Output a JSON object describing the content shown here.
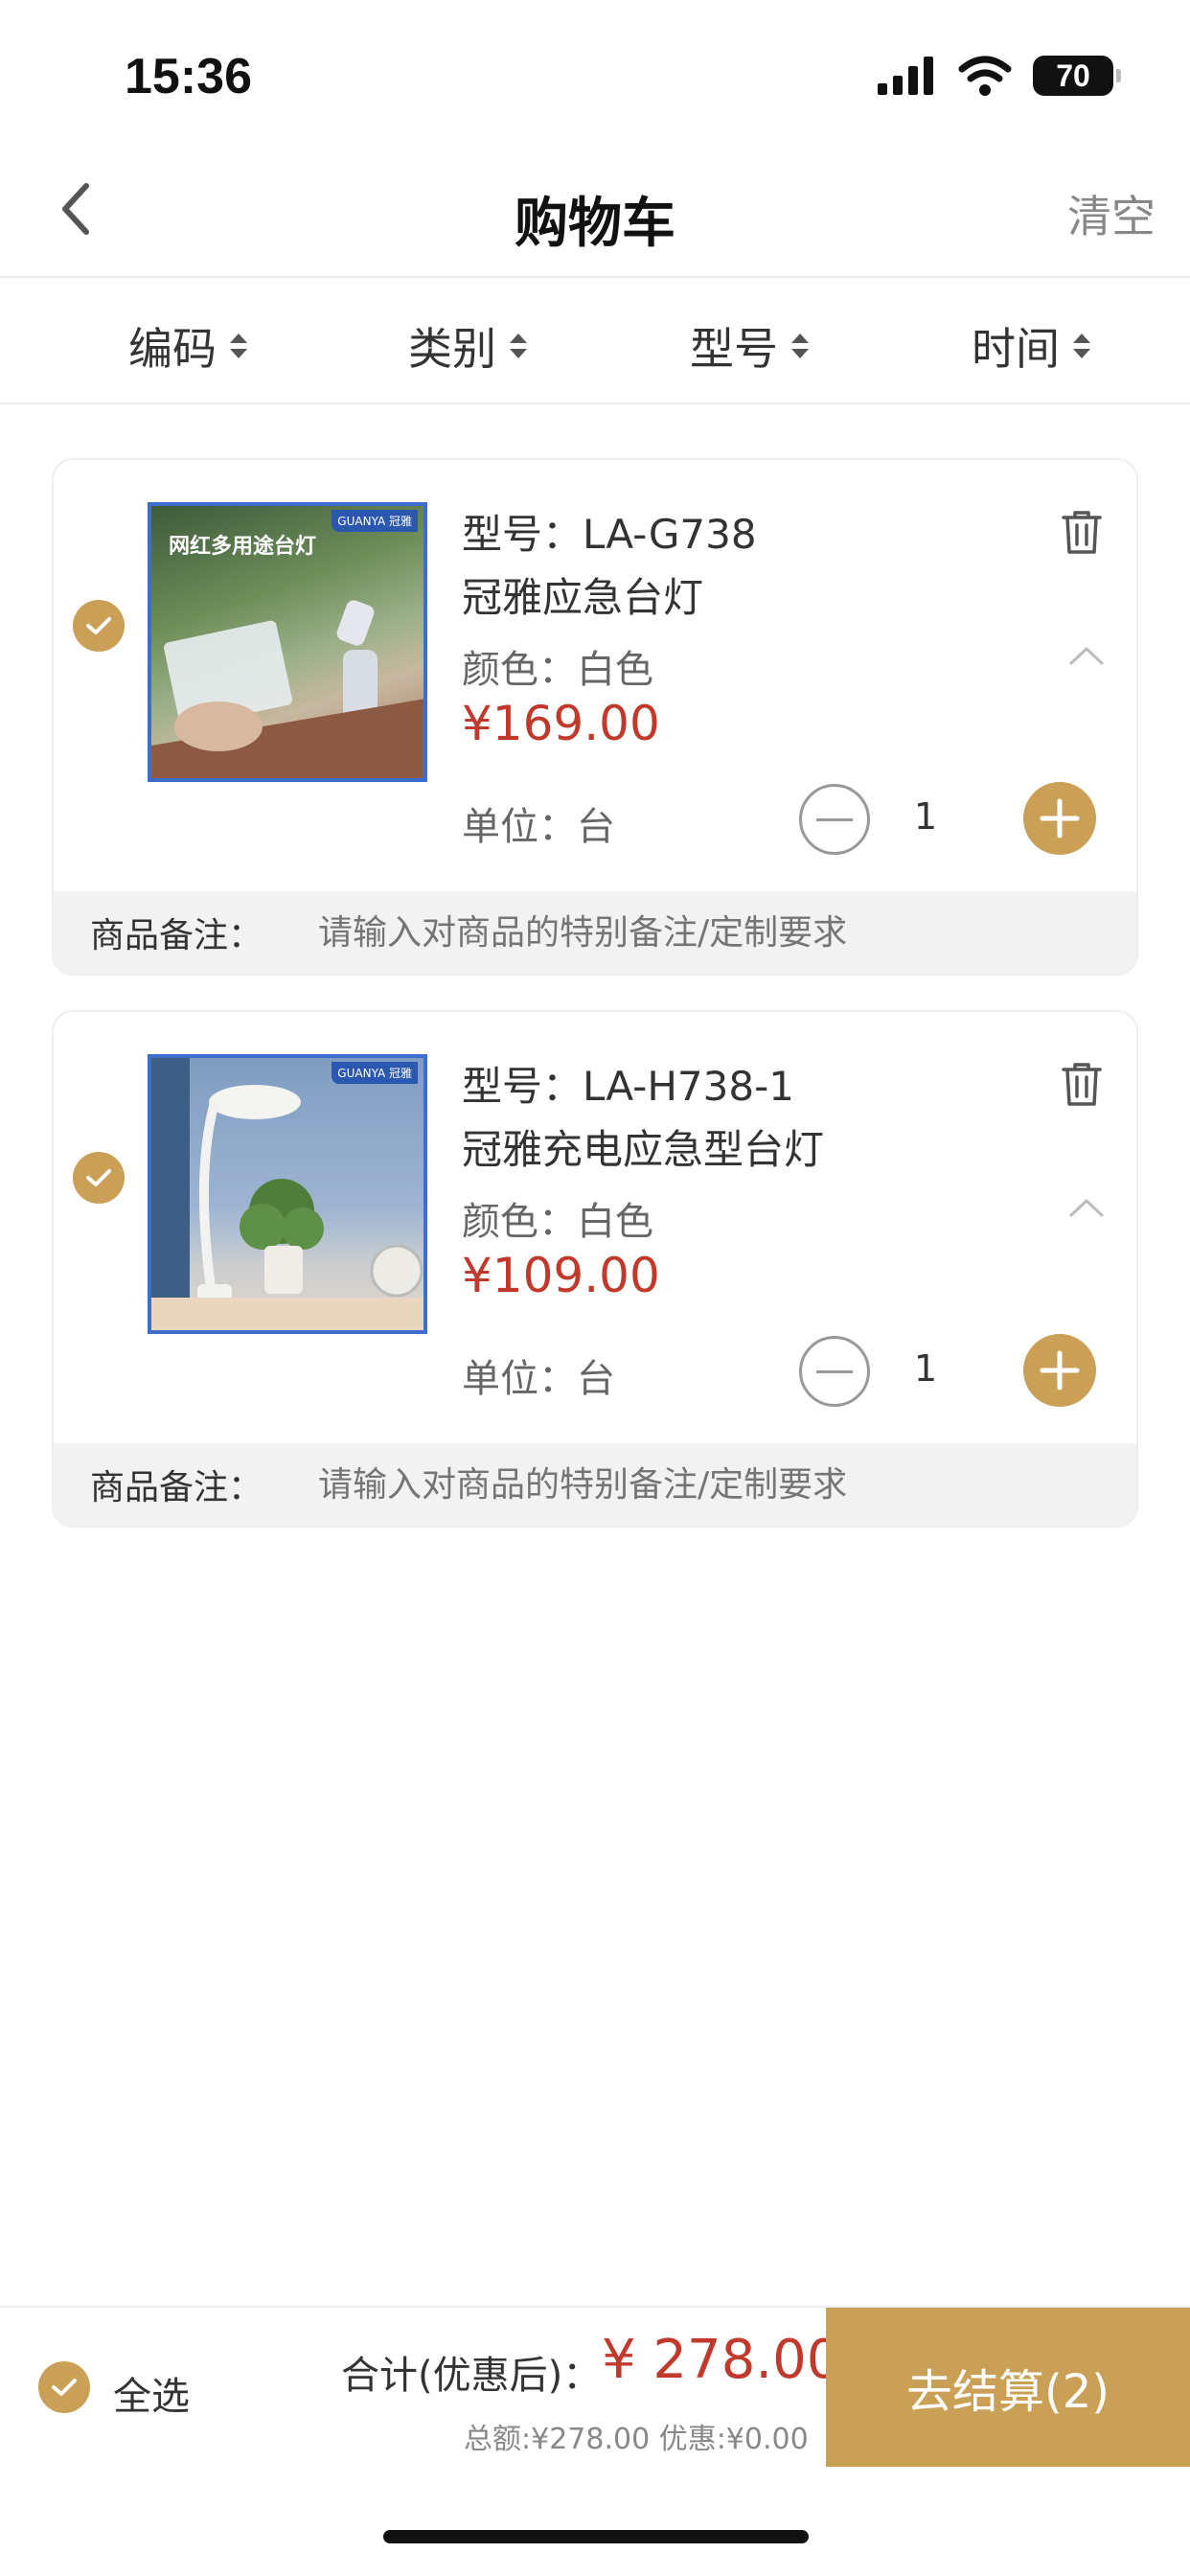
{
  "status_bar": {
    "time": "15:36",
    "battery": "70"
  },
  "nav": {
    "title": "购物车",
    "clear_label": "清空"
  },
  "sort": [
    {
      "label": "编码"
    },
    {
      "label": "类别"
    },
    {
      "label": "型号"
    },
    {
      "label": "时间"
    }
  ],
  "items": [
    {
      "model": "型号：LA-G738",
      "name": "冠雅应急台灯",
      "color": "颜色：白色",
      "price": "¥169.00",
      "unit": "单位：台",
      "quantity": "1",
      "image_caption": "网红多用途台灯",
      "image_brand": "GUANYA 冠雅",
      "selected": true
    },
    {
      "model": "型号：LA-H738-1",
      "name": "冠雅充电应急型台灯",
      "color": "颜色：白色",
      "price": "¥109.00",
      "unit": "单位：台",
      "quantity": "1",
      "image_caption": "",
      "image_brand": "GUANYA 冠雅",
      "selected": true
    }
  ],
  "note": {
    "label": "商品备注：",
    "placeholder": "请输入对商品的特别备注/定制要求"
  },
  "footer": {
    "select_all_label": "全选",
    "total_label": "合计(优惠后)：",
    "total_amount": "¥ 278.00",
    "total_sub": "总额:¥278.00 优惠:¥0.00",
    "checkout_label": "去结算(2)"
  },
  "colors": {
    "accent": "#c9a055",
    "price": "#c0392b"
  }
}
